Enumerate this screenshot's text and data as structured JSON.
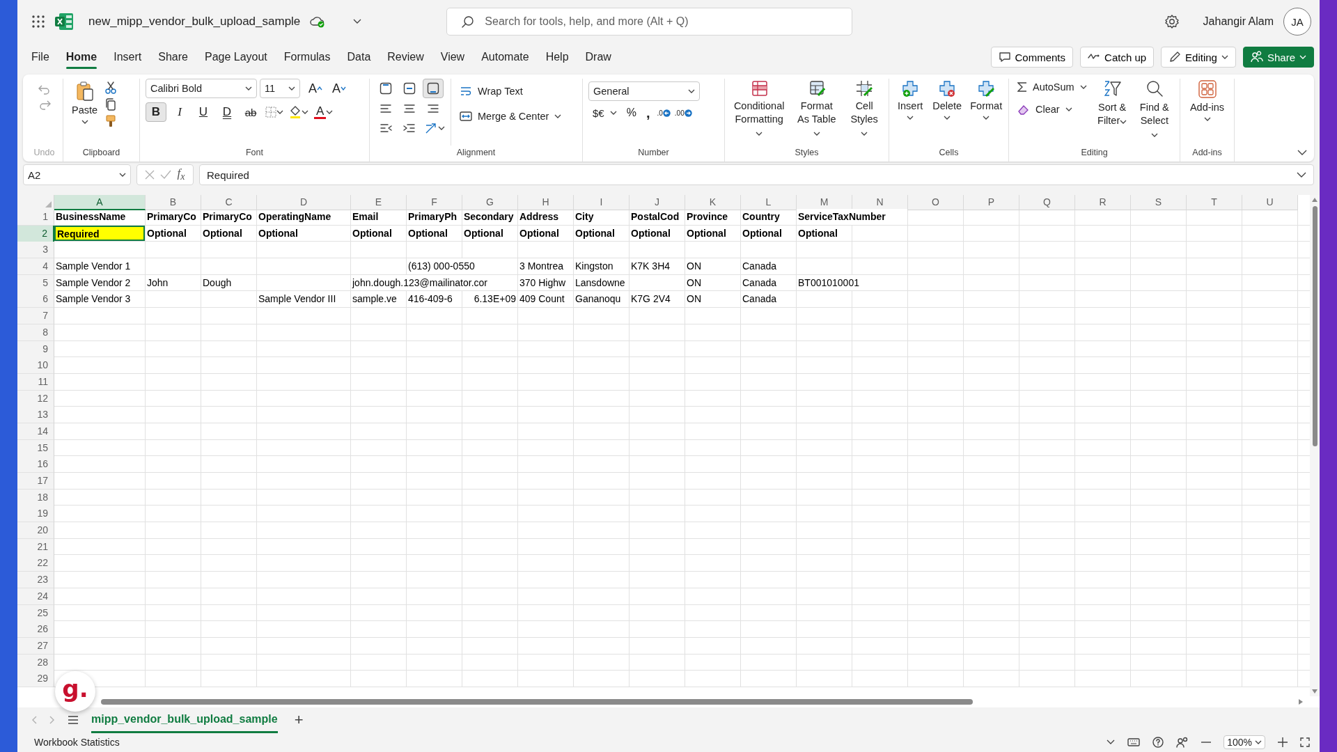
{
  "title_bar": {
    "file_name": "new_mipp_vendor_bulk_upload_sample",
    "search_placeholder": "Search for tools, help, and more (Alt + Q)",
    "user_name": "Jahangir Alam",
    "avatar_initials": "JA"
  },
  "menu_tabs": [
    {
      "label": "File",
      "selected": false
    },
    {
      "label": "Home",
      "selected": true
    },
    {
      "label": "Insert",
      "selected": false
    },
    {
      "label": "Share",
      "selected": false
    },
    {
      "label": "Page Layout",
      "selected": false
    },
    {
      "label": "Formulas",
      "selected": false
    },
    {
      "label": "Data",
      "selected": false
    },
    {
      "label": "Review",
      "selected": false
    },
    {
      "label": "View",
      "selected": false
    },
    {
      "label": "Automate",
      "selected": false
    },
    {
      "label": "Help",
      "selected": false
    },
    {
      "label": "Draw",
      "selected": false
    }
  ],
  "actions": [
    {
      "label": "Comments",
      "kind": "comments"
    },
    {
      "label": "Catch up",
      "kind": "catchup"
    },
    {
      "label": "Editing",
      "kind": "editing"
    },
    {
      "label": "Share",
      "kind": "share"
    }
  ],
  "ribbon": {
    "undo": {
      "label": "Undo",
      "disabled": true
    },
    "clipboard": {
      "paste": "Paste",
      "label": "Clipboard"
    },
    "font": {
      "name": "Calibri Bold",
      "size": "11",
      "grow": "A",
      "shrink": "A",
      "styles": [
        {
          "label": "B",
          "kind": "bold",
          "selected": true
        },
        {
          "label": "I",
          "kind": "italic",
          "selected": false
        },
        {
          "label": "U",
          "kind": "underline",
          "selected": false
        },
        {
          "label": "D",
          "kind": "double",
          "selected": false
        },
        {
          "label": "ab",
          "kind": "strike",
          "selected": false
        }
      ],
      "font_color": "A",
      "label": "Font"
    },
    "alignment": {
      "vertical": [
        {
          "kind": "top",
          "selected": false
        },
        {
          "kind": "middle",
          "selected": false
        },
        {
          "kind": "bottom",
          "selected": true
        }
      ],
      "wrap_text": "Wrap Text",
      "merge": "Merge & Center",
      "label": "Alignment"
    },
    "number": {
      "format": "General",
      "currency": "$€",
      "percent": "%",
      "comma": ",",
      "decimal_increase": ".0",
      "decimal_decrease": ".00",
      "label": "Number"
    },
    "styles": {
      "buttons": [
        {
          "label": "Conditional Formatting",
          "kind": "conditional"
        },
        {
          "label": "Format As Table",
          "kind": "table"
        },
        {
          "label": "Cell Styles",
          "kind": "cellstyles"
        }
      ],
      "label": "Styles"
    },
    "cells": {
      "buttons": [
        {
          "label": "Insert",
          "kind": "insert"
        },
        {
          "label": "Delete",
          "kind": "delete"
        },
        {
          "label": "Format",
          "kind": "format"
        }
      ],
      "label": "Cells"
    },
    "editing": {
      "autosum": "AutoSum",
      "clear": "Clear",
      "sort": "Sort & Filter",
      "find": "Find & Select",
      "label": "Editing"
    },
    "addins": {
      "button": "Add-ins",
      "label": "Add-ins"
    }
  },
  "formula_bar": {
    "name_box": "A2",
    "function_label": "f$_{x}$",
    "value": "Required"
  },
  "columns": [
    {
      "label": "A",
      "selected": true
    },
    {
      "label": "B",
      "selected": false
    },
    {
      "label": "C",
      "selected": false
    },
    {
      "label": "D",
      "selected": false
    },
    {
      "label": "E",
      "selected": false
    },
    {
      "label": "F",
      "selected": false
    },
    {
      "label": "G",
      "selected": false
    },
    {
      "label": "H",
      "selected": false
    },
    {
      "label": "I",
      "selected": false
    },
    {
      "label": "J",
      "selected": false
    },
    {
      "label": "K",
      "selected": false
    },
    {
      "label": "L",
      "selected": false
    },
    {
      "label": "M",
      "selected": false
    },
    {
      "label": "N",
      "selected": false
    },
    {
      "label": "O",
      "selected": false
    },
    {
      "label": "P",
      "selected": false
    },
    {
      "label": "Q",
      "selected": false
    },
    {
      "label": "R",
      "selected": false
    },
    {
      "label": "S",
      "selected": false
    },
    {
      "label": "T",
      "selected": false
    },
    {
      "label": "U",
      "selected": false
    }
  ],
  "rows": [
    {
      "number": "1",
      "selected": false,
      "kind": "header",
      "cells": [
        {
          "text": "BusinessName",
          "kind": "text",
          "selected": false
        },
        {
          "text": "PrimaryCo",
          "kind": "text",
          "selected": false
        },
        {
          "text": "PrimaryCo",
          "kind": "text",
          "selected": false
        },
        {
          "text": "OperatingName",
          "kind": "text",
          "selected": false
        },
        {
          "text": "Email",
          "kind": "text",
          "selected": false
        },
        {
          "text": "PrimaryPh",
          "kind": "text",
          "selected": false
        },
        {
          "text": "Secondary",
          "kind": "text",
          "selected": false
        },
        {
          "text": "Address",
          "kind": "text",
          "selected": false
        },
        {
          "text": "City",
          "kind": "text",
          "selected": false
        },
        {
          "text": "PostalCod",
          "kind": "text",
          "selected": false
        },
        {
          "text": "Province",
          "kind": "text",
          "selected": false
        },
        {
          "text": "Country",
          "kind": "text",
          "selected": false
        },
        {
          "text": "ServiceTaxNumber",
          "kind": "text",
          "selected": false
        }
      ]
    },
    {
      "number": "2",
      "selected": true,
      "kind": "header",
      "cells": [
        {
          "text": "Required",
          "kind": "text",
          "selected": true,
          "color": "#ffff00"
        },
        {
          "text": "Optional",
          "kind": "text",
          "selected": false
        },
        {
          "text": "Optional",
          "kind": "text",
          "selected": false
        },
        {
          "text": "Optional",
          "kind": "text",
          "selected": false
        },
        {
          "text": "Optional",
          "kind": "text",
          "selected": false
        },
        {
          "text": "Optional",
          "kind": "text",
          "selected": false
        },
        {
          "text": "Optional",
          "kind": "text",
          "selected": false
        },
        {
          "text": "Optional",
          "kind": "text",
          "selected": false
        },
        {
          "text": "Optional",
          "kind": "text",
          "selected": false
        },
        {
          "text": "Optional",
          "kind": "text",
          "selected": false
        },
        {
          "text": "Optional",
          "kind": "text",
          "selected": false
        },
        {
          "text": "Optional",
          "kind": "text",
          "selected": false
        },
        {
          "text": "Optional",
          "kind": "text",
          "selected": false
        }
      ]
    },
    {
      "number": "3",
      "selected": false,
      "kind": "data"
    },
    {
      "number": "4",
      "selected": false,
      "kind": "data",
      "cells": [
        {
          "text": "Sample Vendor 1",
          "kind": "text",
          "selected": false
        },
        null,
        null,
        null,
        null,
        {
          "text": "(613) 000-0550",
          "kind": "text",
          "selected": false
        },
        null,
        {
          "text": "3 Montrea",
          "kind": "text",
          "selected": false
        },
        {
          "text": "Kingston",
          "kind": "text",
          "selected": false
        },
        {
          "text": "K7K 3H4",
          "kind": "text",
          "selected": false
        },
        {
          "text": "ON",
          "kind": "text",
          "selected": false
        },
        {
          "text": "Canada",
          "kind": "text",
          "selected": false
        }
      ]
    },
    {
      "number": "5",
      "selected": false,
      "kind": "data",
      "cells": [
        {
          "text": "Sample Vendor 2",
          "kind": "text",
          "selected": false
        },
        {
          "text": "John",
          "kind": "text",
          "selected": false
        },
        {
          "text": "Dough",
          "kind": "text",
          "selected": false
        },
        null,
        {
          "text": "john.dough.123@mailinator.cor",
          "kind": "text",
          "selected": false
        },
        null,
        null,
        {
          "text": "370 Highw",
          "kind": "text",
          "selected": false
        },
        {
          "text": "Lansdowne",
          "kind": "text",
          "selected": false
        },
        null,
        {
          "text": "ON",
          "kind": "text",
          "selected": false
        },
        {
          "text": "Canada",
          "kind": "text",
          "selected": false
        },
        {
          "text": "BT001010001",
          "kind": "text",
          "selected": false
        }
      ]
    },
    {
      "number": "6",
      "selected": false,
      "kind": "data",
      "cells": [
        {
          "text": "Sample Vendor 3",
          "kind": "text",
          "selected": false
        },
        null,
        null,
        {
          "text": "Sample Vendor III",
          "kind": "text",
          "selected": false
        },
        {
          "text": "sample.ve",
          "kind": "text",
          "selected": false
        },
        {
          "text": "416-409-6",
          "kind": "text",
          "selected": false
        },
        {
          "text": "6.13E+09",
          "kind": "number",
          "selected": false
        },
        {
          "text": "409 Count",
          "kind": "text",
          "selected": false
        },
        {
          "text": "Gananoqu",
          "kind": "text",
          "selected": false
        },
        {
          "text": "K7G 2V4",
          "kind": "text",
          "selected": false
        },
        {
          "text": "ON",
          "kind": "text",
          "selected": false
        },
        {
          "text": "Canada",
          "kind": "text",
          "selected": false
        }
      ]
    },
    {
      "number": "7",
      "selected": false,
      "kind": "data"
    },
    {
      "number": "8",
      "selected": false,
      "kind": "data"
    },
    {
      "number": "9",
      "selected": false,
      "kind": "data"
    },
    {
      "number": "10",
      "selected": false,
      "kind": "data"
    },
    {
      "number": "11",
      "selected": false,
      "kind": "data"
    },
    {
      "number": "12",
      "selected": false,
      "kind": "data"
    },
    {
      "number": "13",
      "selected": false,
      "kind": "data"
    },
    {
      "number": "14",
      "selected": false,
      "kind": "data"
    },
    {
      "number": "15",
      "selected": false,
      "kind": "data"
    },
    {
      "number": "16",
      "selected": false,
      "kind": "data"
    },
    {
      "number": "17",
      "selected": false,
      "kind": "data"
    },
    {
      "number": "18",
      "selected": false,
      "kind": "data"
    },
    {
      "number": "19",
      "selected": false,
      "kind": "data"
    },
    {
      "number": "20",
      "selected": false,
      "kind": "data"
    },
    {
      "number": "21",
      "selected": false,
      "kind": "data"
    },
    {
      "number": "22",
      "selected": false,
      "kind": "data"
    },
    {
      "number": "23",
      "selected": false,
      "kind": "data"
    },
    {
      "number": "24",
      "selected": false,
      "kind": "data"
    },
    {
      "number": "25",
      "selected": false,
      "kind": "data"
    },
    {
      "number": "26",
      "selected": false,
      "kind": "data"
    },
    {
      "number": "27",
      "selected": false,
      "kind": "data"
    },
    {
      "number": "28",
      "selected": false,
      "kind": "data"
    },
    {
      "number": "29",
      "selected": false,
      "kind": "data"
    }
  ],
  "sheet_tabs": [
    {
      "label": "mipp_vendor_bulk_upload_sample",
      "selected": true
    }
  ],
  "add_sheet": "+",
  "status_bar": {
    "left": "Workbook Statistics",
    "zoom": "100%"
  },
  "floating_badge": {
    "text": "g."
  }
}
